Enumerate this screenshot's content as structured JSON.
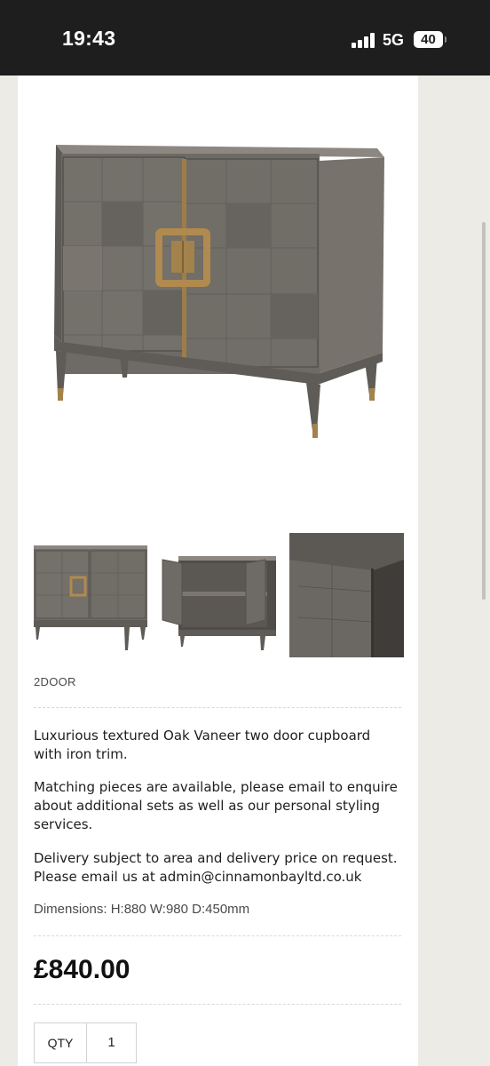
{
  "status_bar": {
    "time": "19:43",
    "network": "5G",
    "battery": "40"
  },
  "product": {
    "sku": "2DOOR",
    "description": [
      "Luxurious textured Oak Vaneer two door cupboard with iron trim.",
      "Matching pieces are available, please email to enquire about additional sets as well as our personal styling services.",
      "Delivery subject to area and delivery price on request. Please email us at admin@cinnamonbayltd.co.uk"
    ],
    "dimensions": "Dimensions: H:880 W:980 D:450mm",
    "price": "£840.00",
    "qty_label": "QTY",
    "qty_value": "1"
  },
  "colors": {
    "page_bg": "#ecebe6",
    "status_bar_bg": "#1e1e1e",
    "wood": "#6e6a65",
    "brass": "#b08a4e"
  },
  "icons": [
    "signal-bars-icon",
    "battery-icon"
  ]
}
